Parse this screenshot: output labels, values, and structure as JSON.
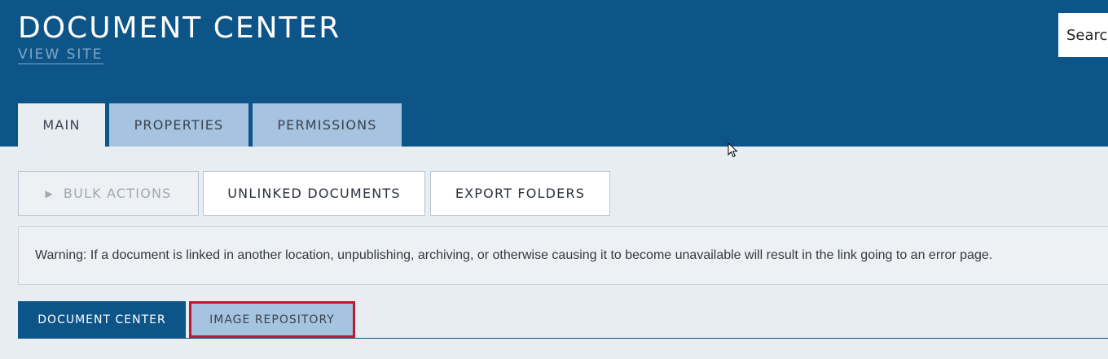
{
  "header": {
    "title": "DOCUMENT CENTER",
    "view_site": "VIEW SITE",
    "search_placeholder": "Search"
  },
  "top_tabs": [
    {
      "label": "MAIN",
      "active": true
    },
    {
      "label": "PROPERTIES",
      "active": false
    },
    {
      "label": "PERMISSIONS",
      "active": false
    }
  ],
  "actions": {
    "bulk_actions": "BULK ACTIONS",
    "bulk_icon": "play-triangle-icon",
    "unlinked_documents": "UNLINKED DOCUMENTS",
    "export_folders": "EXPORT FOLDERS"
  },
  "warning": {
    "text": "Warning: If a document is linked in another location, unpublishing, archiving, or otherwise causing it to become unavailable will result in the link going to an error page."
  },
  "sub_tabs": [
    {
      "label": "DOCUMENT CENTER",
      "active": true
    },
    {
      "label": "IMAGE REPOSITORY",
      "active": false,
      "highlighted": true
    }
  ],
  "colors": {
    "header_bg": "#0d5588",
    "tab_inactive": "#a6c3e0",
    "page_bg": "#e8edf2",
    "highlight_border": "#c0182d"
  }
}
